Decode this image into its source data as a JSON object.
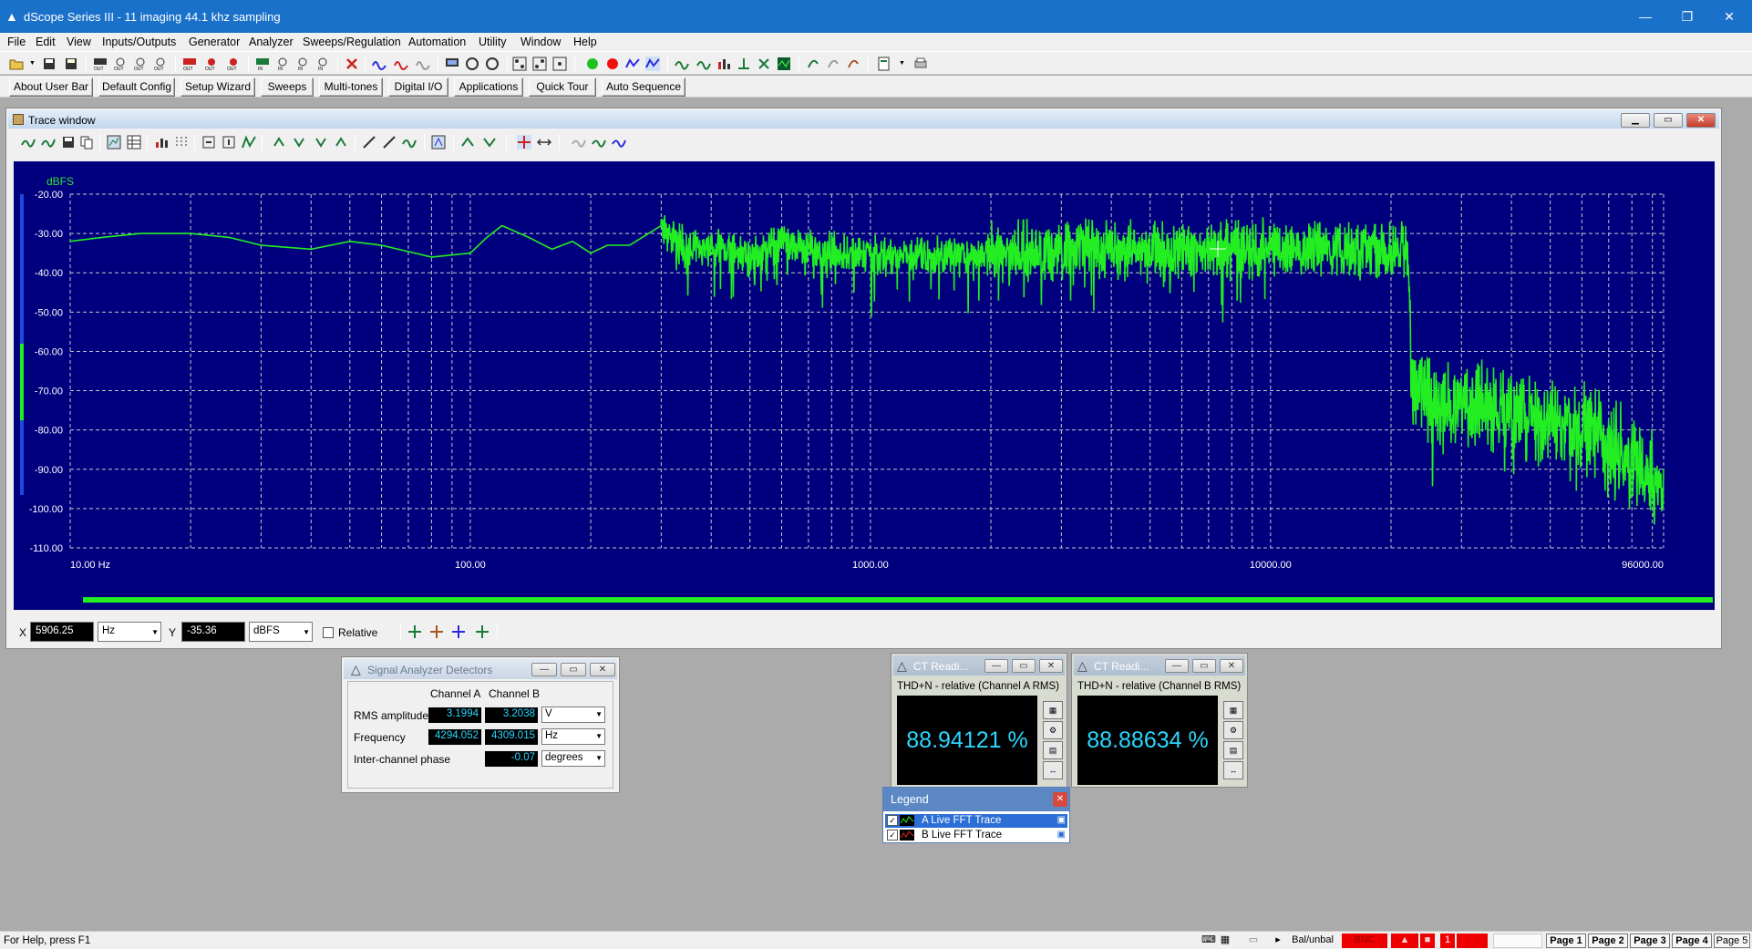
{
  "window": {
    "title": "dScope Series III - 11  imaging 44.1 khz sampling"
  },
  "menu": [
    "File",
    "Edit",
    "View",
    "Inputs/Outputs",
    "Generator",
    "Analyzer",
    "Sweeps/Regulation",
    "Automation",
    "Utility",
    "Window",
    "Help"
  ],
  "userbar": [
    "About User Bar",
    "Default Config",
    "Setup Wizard",
    "Sweeps",
    "Multi-tones",
    "Digital I/O",
    "Applications",
    "Quick Tour",
    "Auto Sequence"
  ],
  "trace": {
    "title": "Trace window",
    "cursor": {
      "x_label": "X",
      "x_value": "5906.25",
      "x_unit": "Hz",
      "y_label": "Y",
      "y_value": "-35.36",
      "y_unit": "dBFS",
      "relative_label": "Relative"
    }
  },
  "chart_data": {
    "type": "line",
    "title": "",
    "xlabel": "",
    "ylabel": "dBFS",
    "x_scale": "log",
    "xlim": [
      10,
      96000
    ],
    "ylim": [
      -110,
      -20
    ],
    "y_tick_labels": [
      "-20.00",
      "-30.00",
      "-40.00",
      "-50.00",
      "-60.00",
      "-70.00",
      "-80.00",
      "-90.00",
      "-100.00",
      "-110.00"
    ],
    "x_tick_labels": [
      {
        "value": 10,
        "label": "10.00 Hz"
      },
      {
        "value": 100,
        "label": "100.00"
      },
      {
        "value": 1000,
        "label": "1000.00"
      },
      {
        "value": 10000,
        "label": "10000.00"
      },
      {
        "value": 96000,
        "label": "96000.00"
      }
    ],
    "grid": true,
    "background": "#00007f",
    "grid_color": "#c8c8c8",
    "series": [
      {
        "color": "#22ee22",
        "x": [
          10,
          12,
          15,
          20,
          25,
          30,
          40,
          50,
          60,
          80,
          100,
          110,
          120,
          140,
          160,
          180,
          200,
          220,
          250,
          300,
          350,
          400,
          500,
          600,
          700,
          800,
          1000,
          1500,
          2000,
          3000,
          4000,
          5000,
          6000,
          8000,
          10000,
          12000,
          15000,
          20000,
          22050,
          22500,
          25000,
          30000,
          40000,
          50000,
          60000,
          70000,
          80000,
          90000,
          96000
        ],
        "y": [
          -32,
          -31,
          -30,
          -30,
          -31,
          -33,
          -34,
          -32,
          -33,
          -36,
          -35,
          -31,
          -28,
          -31,
          -34,
          -32,
          -35,
          -33,
          -33,
          -28,
          -35,
          -33,
          -36,
          -32,
          -34,
          -35,
          -36,
          -36,
          -35,
          -34,
          -34,
          -34,
          -34,
          -34,
          -34,
          -34,
          -34,
          -34,
          -34,
          -65,
          -73,
          -74,
          -75,
          -77,
          -80,
          -84,
          -88,
          -92,
          -96
        ]
      }
    ]
  },
  "detectors": {
    "title": "Signal Analyzer Detectors",
    "col_a": "Channel A",
    "col_b": "Channel B",
    "rows": [
      {
        "label": "RMS amplitude",
        "a": "3.1994",
        "b": "3.2038",
        "unit": "V"
      },
      {
        "label": "Frequency",
        "a": "4294.052",
        "b": "4309.015",
        "unit": "Hz"
      },
      {
        "label": "Inter-channel phase",
        "a": "",
        "b": "-0.07",
        "unit": "degrees"
      }
    ]
  },
  "ct_a": {
    "title": "CT Readi...",
    "caption": "THD+N - relative (Channel A RMS)",
    "value": "88.94121 %"
  },
  "ct_b": {
    "title": "CT Readi...",
    "caption": "THD+N - relative (Channel B RMS)",
    "value": "88.88634 %"
  },
  "legend": {
    "title": "Legend",
    "items": [
      {
        "label": "A  Live FFT Trace",
        "color": "#22ee22",
        "selected": true
      },
      {
        "label": "B  Live FFT Trace",
        "color": "#ee2222",
        "selected": false
      }
    ]
  },
  "status": {
    "help": "For Help, press F1",
    "mode": "Bal/unbal",
    "bnc": "BNC",
    "counter": "1",
    "pages": [
      "Page 1",
      "Page 2",
      "Page 3",
      "Page 4",
      "Page 5"
    ]
  }
}
